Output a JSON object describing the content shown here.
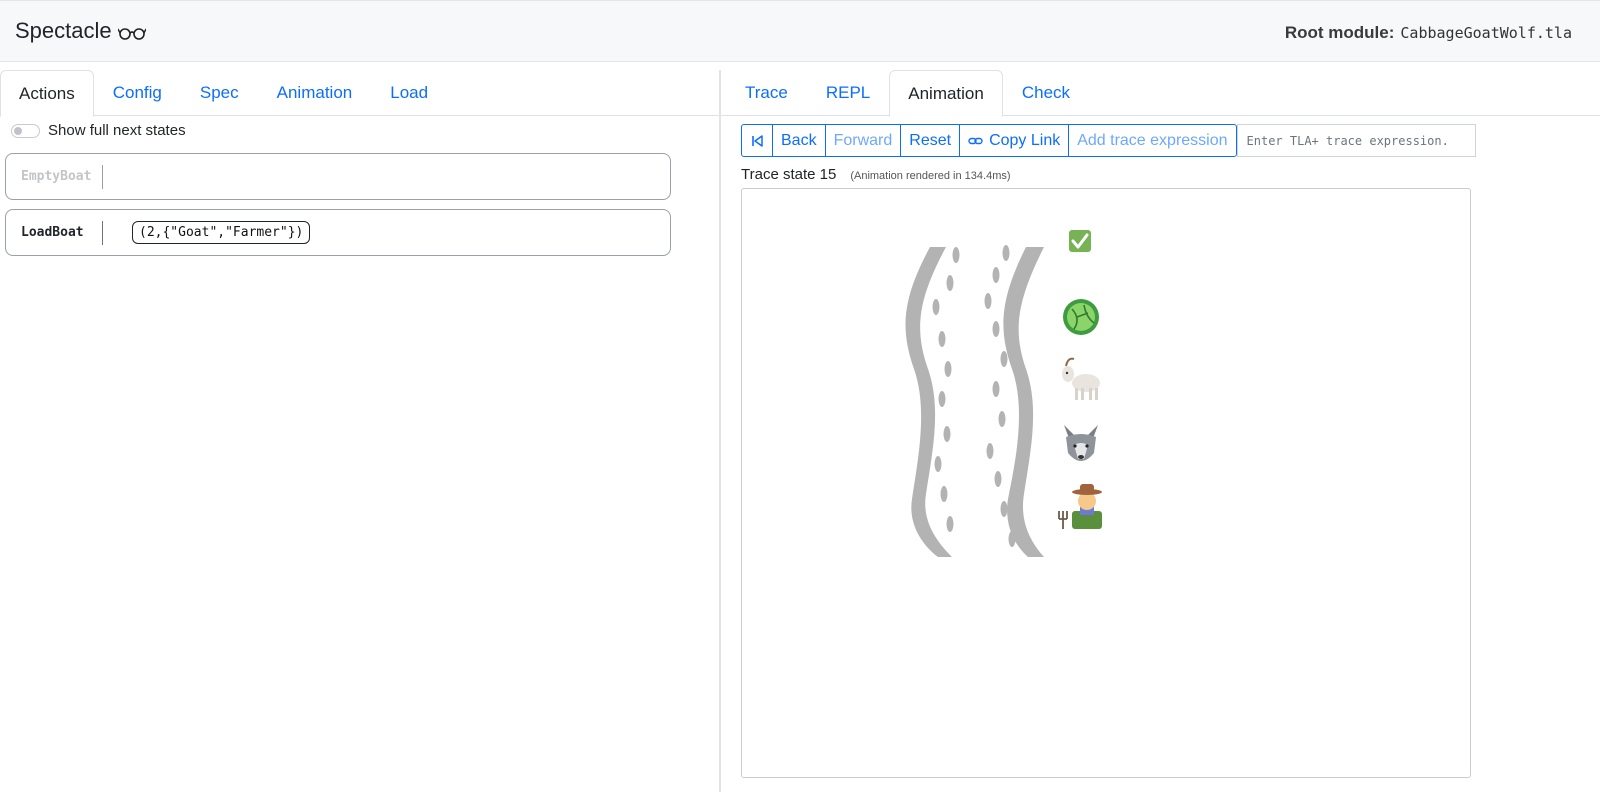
{
  "header": {
    "app_title": "Spectacle",
    "glasses_glyph": "👓",
    "root_module_label": "Root module:",
    "root_module_file": "CabbageGoatWolf.tla"
  },
  "left": {
    "tabs": [
      {
        "label": "Actions",
        "active": true
      },
      {
        "label": "Config",
        "active": false
      },
      {
        "label": "Spec",
        "active": false
      },
      {
        "label": "Animation",
        "active": false
      },
      {
        "label": "Load",
        "active": false
      }
    ],
    "toggle_label": "Show full next states",
    "actions": [
      {
        "name": "EmptyBoat",
        "enabled": false,
        "param": ""
      },
      {
        "name": "LoadBoat",
        "enabled": true,
        "param": "(2,{\"Goat\",\"Farmer\"})"
      }
    ]
  },
  "right": {
    "tabs": [
      {
        "label": "Trace",
        "active": false
      },
      {
        "label": "REPL",
        "active": false
      },
      {
        "label": "Animation",
        "active": true
      },
      {
        "label": "Check",
        "active": false
      }
    ],
    "controls": {
      "first_icon": "skip-to-start-icon",
      "back": "Back",
      "forward": "Forward",
      "reset": "Reset",
      "copy_link": "Copy Link",
      "add_trace_expression": "Add trace expression",
      "trace_input_placeholder": "Enter TLA+ trace expression."
    },
    "trace_state_title": "Trace state 15",
    "animation_timing": "(Animation rendered in 134.4ms)",
    "animation": {
      "goal_icon": "check-mark-icon",
      "items": [
        "cabbage-icon",
        "goat-icon",
        "wolf-icon",
        "farmer-icon"
      ],
      "items_side": "right"
    }
  },
  "colors": {
    "accent": "#0d6efd",
    "header_bg": "#f7f8fa",
    "river": "#b3b3b3",
    "check": "#77b255"
  }
}
